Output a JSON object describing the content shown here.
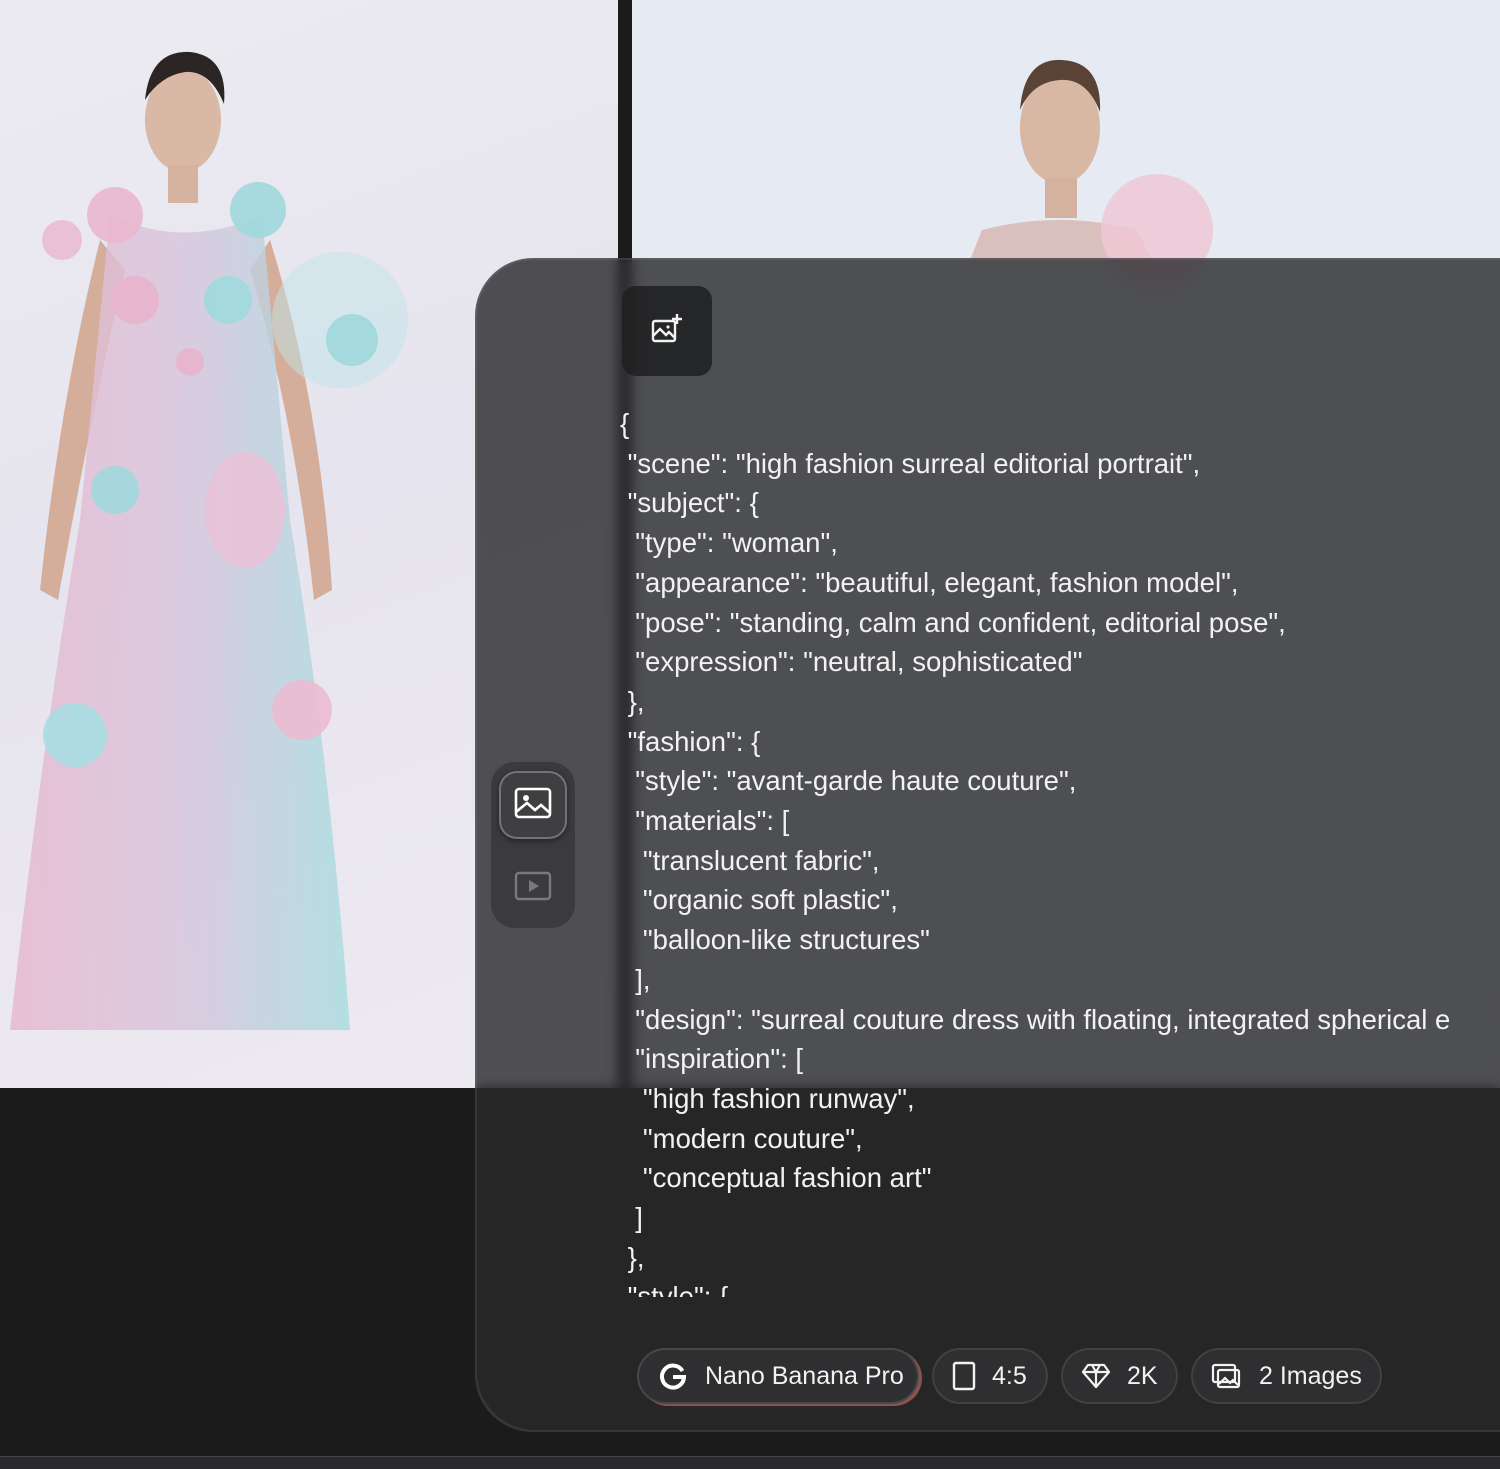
{
  "prompt": {
    "json_text": "{\n \"scene\": \"high fashion surreal editorial portrait\",\n \"subject\": {\n  \"type\": \"woman\",\n  \"appearance\": \"beautiful, elegant, fashion model\",\n  \"pose\": \"standing, calm and confident, editorial pose\",\n  \"expression\": \"neutral, sophisticated\"\n },\n \"fashion\": {\n  \"style\": \"avant-garde haute couture\",\n  \"materials\": [\n   \"translucent fabric\",\n   \"organic soft plastic\",\n   \"balloon-like structures\"\n  ],\n  \"design\": \"surreal couture dress with floating, integrated spherical e\n  \"inspiration\": [\n   \"high fashion runway\",\n   \"modern couture\",\n   \"conceptual fashion art\"\n  ]\n },\n \"style\": {"
  },
  "toolbar": {
    "model_label": "Nano Banana Pro",
    "aspect_ratio": "4:5",
    "resolution": "2K",
    "image_count": "2 Images"
  },
  "colors": {
    "panel_bg": "#28282a",
    "chip_bg": "#2f2f31",
    "text": "#f2f2f2",
    "model_accent": "#dc786e"
  },
  "icons": {
    "add_image": "image-add-icon",
    "mode_image": "image-icon",
    "mode_video": "play-icon",
    "model": "google-g-icon",
    "ratio": "aspect-ratio-icon",
    "resolution": "diamond-icon",
    "count": "images-stack-icon"
  }
}
